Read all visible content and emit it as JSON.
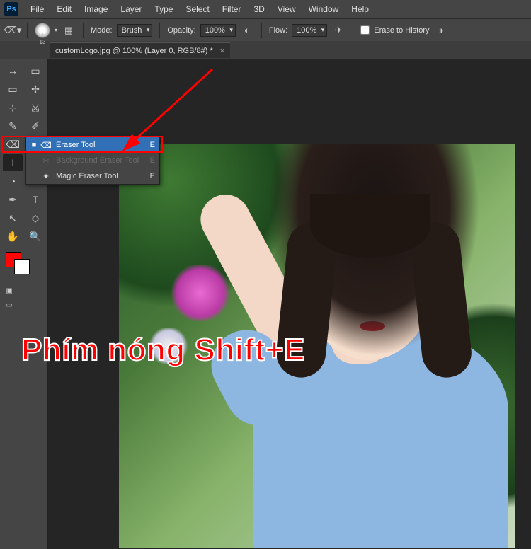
{
  "app": {
    "logo": "Ps"
  },
  "menus": [
    "File",
    "Edit",
    "Image",
    "Layer",
    "Type",
    "Select",
    "Filter",
    "3D",
    "View",
    "Window",
    "Help"
  ],
  "options": {
    "brush_size": "13",
    "mode_label": "Mode:",
    "mode_value": "Brush",
    "opacity_label": "Opacity:",
    "opacity_value": "100%",
    "flow_label": "Flow:",
    "flow_value": "100%",
    "erase_history_label": "Erase to History"
  },
  "tab": {
    "title": "customLogo.jpg @ 100% (Layer 0, RGB/8#) *",
    "close": "×"
  },
  "tools_left": [
    "↔",
    "▭",
    "⊹",
    "✎",
    "⌫",
    "⟊",
    "◔",
    "✒",
    "↖",
    "⬚",
    "✋",
    "▭"
  ],
  "tools_right": [
    "▭",
    "✢",
    "⤩",
    "✐",
    "⎀",
    "⌀",
    "●",
    "T",
    "◇",
    "🔍",
    "…",
    "⋯"
  ],
  "flyout": {
    "items": [
      {
        "mark": "■",
        "icon": "⌫",
        "name": "Eraser Tool",
        "shortcut": "E",
        "selected": true
      },
      {
        "mark": "",
        "icon": "✂",
        "name": "Background Eraser Tool",
        "shortcut": "E",
        "dim": true
      },
      {
        "mark": "",
        "icon": "✦",
        "name": "Magic Eraser Tool",
        "shortcut": "E"
      }
    ]
  },
  "annotation": {
    "hotkey_text": "Phím nóng Shift+E"
  },
  "colors": {
    "foreground": "#ff0505",
    "background": "#ffffff",
    "ui_bg": "#454545",
    "accent_blue": "#3170b7",
    "highlight_red": "#ff0000"
  }
}
